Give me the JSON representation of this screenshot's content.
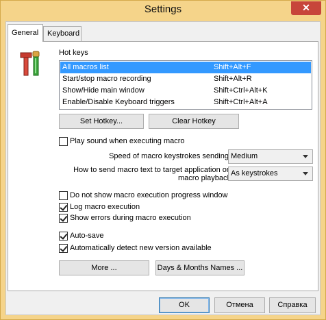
{
  "window": {
    "title": "Settings",
    "close_glyph": "✕"
  },
  "tabs": [
    {
      "label": "General",
      "active": true
    },
    {
      "label": "Keyboard",
      "active": false
    }
  ],
  "hotkeys": {
    "heading": "Hot keys",
    "rows": [
      {
        "name": "All macros list",
        "key": "Shift+Alt+F",
        "selected": true
      },
      {
        "name": "Start/stop macro recording",
        "key": "Shift+Alt+R",
        "selected": false
      },
      {
        "name": "Show/Hide main window",
        "key": "Shift+Ctrl+Alt+K",
        "selected": false
      },
      {
        "name": "Enable/Disable Keyboard triggers",
        "key": "Shift+Ctrl+Alt+A",
        "selected": false
      }
    ],
    "set_label": "Set Hotkey...",
    "clear_label": "Clear Hotkey"
  },
  "options": {
    "play_sound": {
      "label": "Play sound when executing macro",
      "checked": false
    },
    "speed": {
      "label": "Speed of macro keystrokes sending:",
      "value": "Medium"
    },
    "send_method": {
      "label_line1": "How to send macro text to target application on",
      "label_line2": "macro playback",
      "value": "As keystrokes"
    },
    "no_progress": {
      "label": "Do not show macro execution progress window",
      "checked": false
    },
    "log_exec": {
      "label": "Log macro execution",
      "checked": true
    },
    "show_errors": {
      "label": "Show errors during macro execution",
      "checked": true
    },
    "auto_save": {
      "label": "Auto-save",
      "checked": true
    },
    "auto_update": {
      "label": "Automatically detect new version available",
      "checked": true
    }
  },
  "buttons": {
    "more": "More ...",
    "days_months": "Days & Months Names ..."
  },
  "footer": {
    "ok": "OK",
    "cancel": "Отмена",
    "help": "Справка"
  },
  "colors": {
    "selection": "#3399ff",
    "close": "#c7453a",
    "frame": "#f5d48a"
  }
}
